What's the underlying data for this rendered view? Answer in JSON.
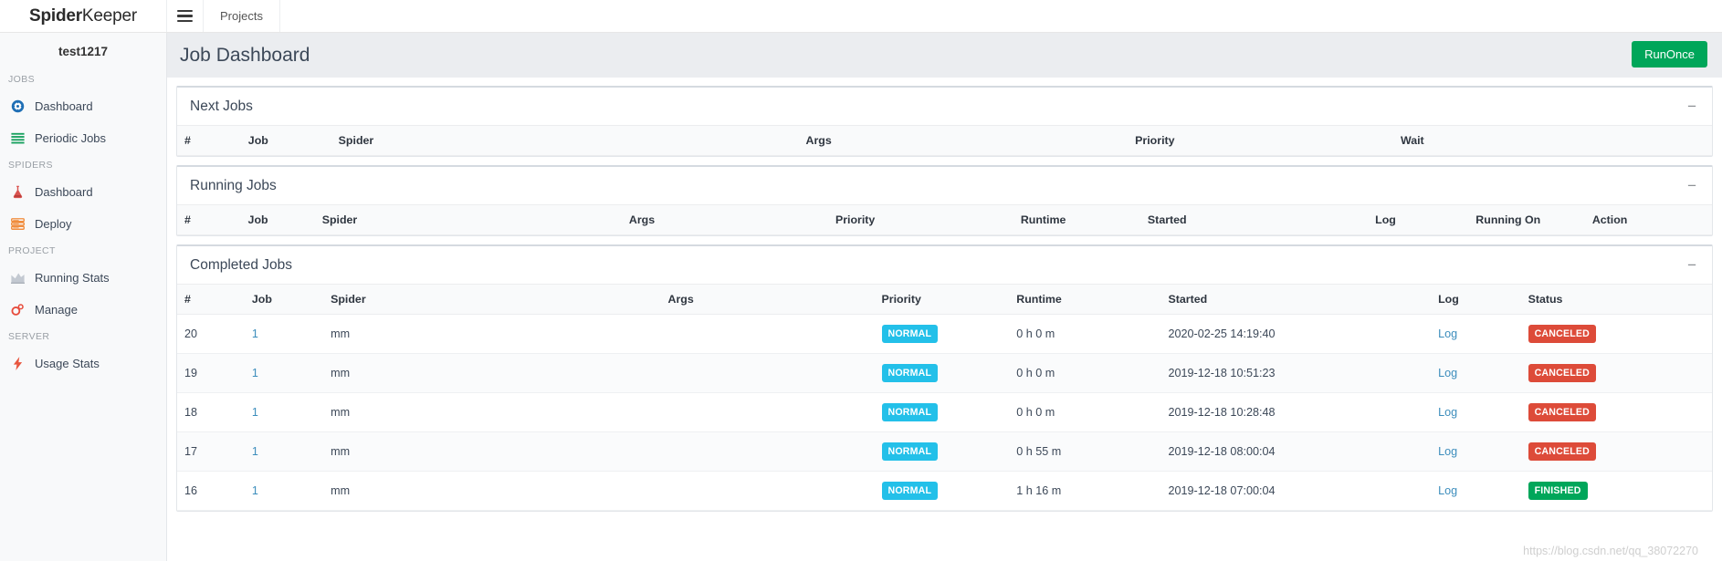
{
  "navbar": {
    "brand_bold": "Spider",
    "brand_light": "Keeper",
    "menu_icon": "hamburger-icon",
    "projects_label": "Projects"
  },
  "sidebar": {
    "project_name": "test1217",
    "sections": [
      {
        "title": "JOBS",
        "items": [
          {
            "label": "Dashboard",
            "icon": "dashboard-gauge-icon",
            "color": "#1f6fb5"
          },
          {
            "label": "Periodic Jobs",
            "icon": "list-lines-icon",
            "color": "#16a05d"
          }
        ]
      },
      {
        "title": "SPIDERS",
        "items": [
          {
            "label": "Dashboard",
            "icon": "flask-icon",
            "color": "#d9534f"
          },
          {
            "label": "Deploy",
            "icon": "server-stack-icon",
            "color": "#ef7d22"
          }
        ]
      },
      {
        "title": "PROJECT",
        "items": [
          {
            "label": "Running Stats",
            "icon": "area-chart-icon",
            "color": "#b6bcc4"
          },
          {
            "label": "Manage",
            "icon": "gears-icon",
            "color": "#e74c3c"
          }
        ]
      },
      {
        "title": "SERVER",
        "items": [
          {
            "label": "Usage Stats",
            "icon": "lightning-bolt-icon",
            "color": "#e8563f"
          }
        ]
      }
    ]
  },
  "page": {
    "title": "Job Dashboard",
    "run_once_label": "RunOnce",
    "run_once_color": "#00a65a",
    "collapse_glyph": "−"
  },
  "panels": {
    "next_jobs": {
      "title": "Next Jobs",
      "columns": [
        "#",
        "Job",
        "Spider",
        "Args",
        "Priority",
        "Wait"
      ],
      "rows": []
    },
    "running_jobs": {
      "title": "Running Jobs",
      "columns": [
        "#",
        "Job",
        "Spider",
        "Args",
        "Priority",
        "Runtime",
        "Started",
        "Log",
        "Running On",
        "Action"
      ],
      "rows": []
    },
    "completed_jobs": {
      "title": "Completed Jobs",
      "columns": [
        "#",
        "Job",
        "Spider",
        "Args",
        "Priority",
        "Runtime",
        "Started",
        "Log",
        "Status"
      ],
      "rows": [
        {
          "id": "20",
          "job": "1",
          "spider": "mm",
          "args": "",
          "priority": "NORMAL",
          "runtime": "0 h 0 m",
          "started": "2020-02-25 14:19:40",
          "log": "Log",
          "status": "CANCELED"
        },
        {
          "id": "19",
          "job": "1",
          "spider": "mm",
          "args": "",
          "priority": "NORMAL",
          "runtime": "0 h 0 m",
          "started": "2019-12-18 10:51:23",
          "log": "Log",
          "status": "CANCELED"
        },
        {
          "id": "18",
          "job": "1",
          "spider": "mm",
          "args": "",
          "priority": "NORMAL",
          "runtime": "0 h 0 m",
          "started": "2019-12-18 10:28:48",
          "log": "Log",
          "status": "CANCELED"
        },
        {
          "id": "17",
          "job": "1",
          "spider": "mm",
          "args": "",
          "priority": "NORMAL",
          "runtime": "0 h 55 m",
          "started": "2019-12-18 08:00:04",
          "log": "Log",
          "status": "CANCELED"
        },
        {
          "id": "16",
          "job": "1",
          "spider": "mm",
          "args": "",
          "priority": "NORMAL",
          "runtime": "1 h 16 m",
          "started": "2019-12-18 07:00:04",
          "log": "Log",
          "status": "FINISHED"
        }
      ]
    }
  },
  "badge_colors": {
    "NORMAL": "#23c0e9",
    "CANCELED": "#dd4b39",
    "FINISHED": "#00a65a"
  },
  "watermark": "https://blog.csdn.net/qq_38072270"
}
